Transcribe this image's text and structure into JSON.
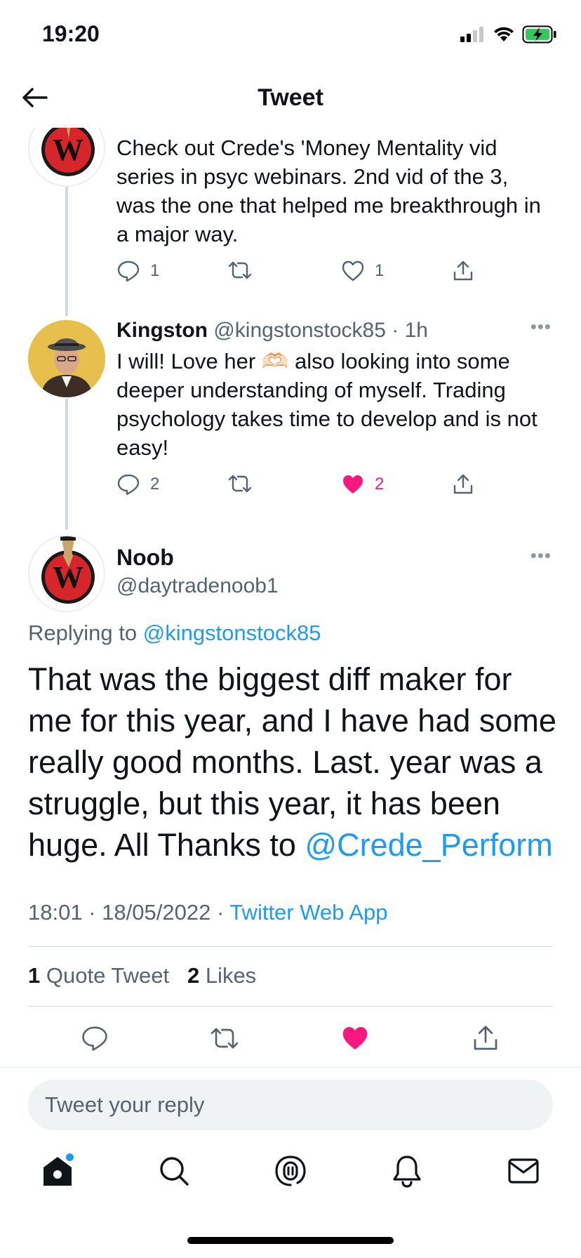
{
  "status_bar": {
    "time": "19:20"
  },
  "nav": {
    "title": "Tweet"
  },
  "parent_tweet": {
    "text": "Check out Crede's 'Money Mentality vid series in psyc webinars. 2nd vid of the 3, was the one that helped me breakthrough in a major way.",
    "reply_count": "1",
    "like_count": "1"
  },
  "kingston_tweet": {
    "name": "Kingston",
    "handle": "@kingstonstock85",
    "time": "· 1h",
    "text_before_emoji": "I will! Love her ",
    "emoji": "🫶🏻",
    "text_after_emoji": " also looking into some deeper understanding of myself. Trading psychology takes time to develop and is not easy!",
    "reply_count": "2",
    "like_count": "2"
  },
  "main_tweet": {
    "name": "Noob",
    "handle": "@daytradenoob1",
    "replying_prefix": "Replying to ",
    "replying_to": "@kingstonstock85",
    "text": "That was the biggest diff maker for me for this year, and I have had some really good months. Last. year was a struggle, but this year, it has been huge. All Thanks to ",
    "mention": "@Crede_Perform",
    "time": "18:01",
    "date": "18/05/2022",
    "source": "Twitter Web App",
    "quote_count": "1",
    "quote_label": "Quote Tweet",
    "like_count": "2",
    "likes_label": "Likes"
  },
  "reply_input": {
    "placeholder": "Tweet your reply"
  },
  "tab_bar": {
    "items": [
      "home-icon",
      "search-icon",
      "spaces-icon",
      "notifications-icon",
      "messages-icon"
    ]
  },
  "colors": {
    "accent": "#1d9bf0",
    "like": "#f91880",
    "muted": "#536471",
    "battery": "#34c759"
  }
}
